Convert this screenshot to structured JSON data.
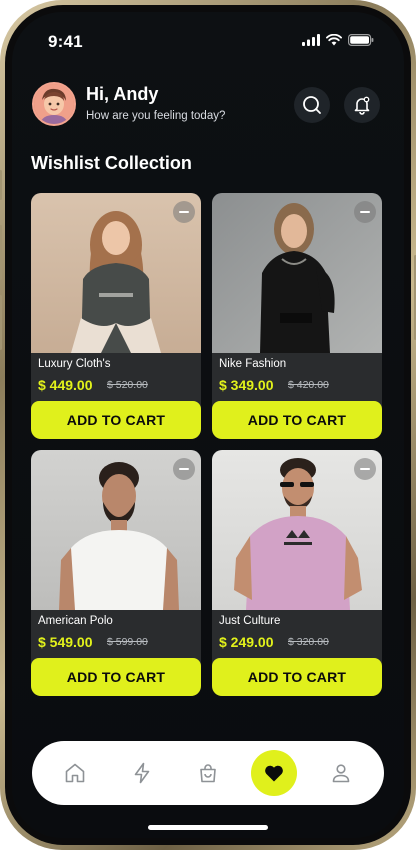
{
  "status": {
    "time": "9:41"
  },
  "header": {
    "greeting": "Hi, Andy",
    "subtitle": "How are you feeling today?"
  },
  "section_title": "Wishlist Collection",
  "colors": {
    "accent": "#e0f01c",
    "background": "#0b0d10",
    "card": "#2a2c2e"
  },
  "products": [
    {
      "name": "Luxury Cloth's",
      "price": "$ 449.00",
      "old_price": "$ 520.00",
      "cta": "ADD TO CART"
    },
    {
      "name": "Nike Fashion",
      "price": "$ 349.00",
      "old_price": "$ 420.00",
      "cta": "ADD TO CART"
    },
    {
      "name": "American Polo",
      "price": "$ 549.00",
      "old_price": "$ 599.00",
      "cta": "ADD TO CART"
    },
    {
      "name": "Just Culture",
      "price": "$ 249.00",
      "old_price": "$ 320.00",
      "cta": "ADD TO CART"
    }
  ],
  "nav": {
    "items": [
      {
        "icon": "home-icon"
      },
      {
        "icon": "lightning-icon"
      },
      {
        "icon": "shopping-bag-icon"
      },
      {
        "icon": "heart-icon",
        "active": true
      },
      {
        "icon": "user-icon"
      }
    ]
  }
}
